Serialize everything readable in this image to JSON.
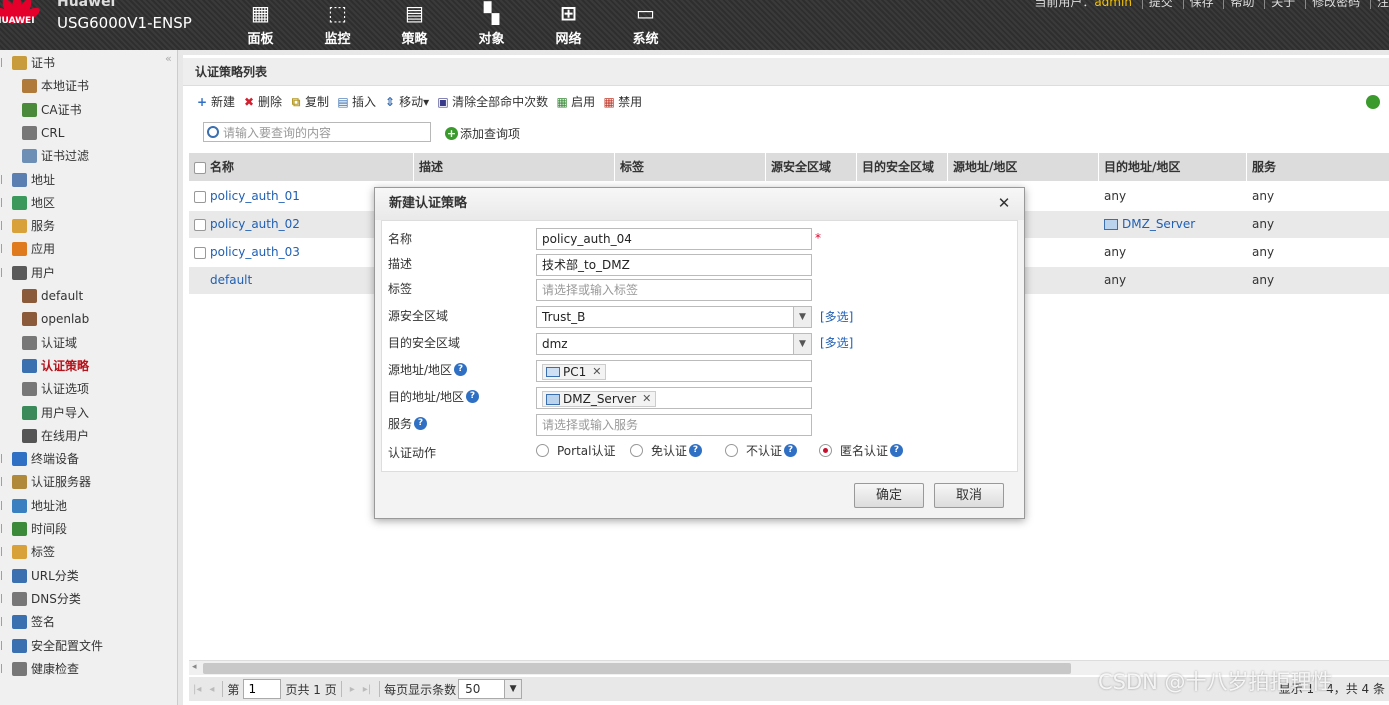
{
  "header": {
    "brand": "Huawei",
    "logo_word": "HUAWEI",
    "device": "USG6000V1-ENSP",
    "nav": [
      {
        "label": "面板",
        "icon": "dashboard-icon"
      },
      {
        "label": "监控",
        "icon": "monitor-icon"
      },
      {
        "label": "策略",
        "icon": "policy-icon"
      },
      {
        "label": "对象",
        "icon": "object-icon"
      },
      {
        "label": "网络",
        "icon": "network-icon"
      },
      {
        "label": "系统",
        "icon": "system-icon"
      }
    ],
    "current_user_label": "当前用户：",
    "current_user": "admin",
    "links": [
      "提交",
      "保存",
      "帮助",
      "关于",
      "修改密码",
      "注"
    ]
  },
  "sidebar": {
    "items": [
      {
        "label": "证书",
        "level": 0,
        "icon": "certificate-icon",
        "color": "#c89b3c"
      },
      {
        "label": "本地证书",
        "level": 1,
        "icon": "local-cert-icon",
        "color": "#b07a3a"
      },
      {
        "label": "CA证书",
        "level": 1,
        "icon": "ca-cert-icon",
        "color": "#4a8a3a"
      },
      {
        "label": "CRL",
        "level": 1,
        "icon": "crl-icon",
        "color": "#777777"
      },
      {
        "label": "证书过滤",
        "level": 1,
        "icon": "cert-filter-icon",
        "color": "#6d8fb5"
      },
      {
        "label": "地址",
        "level": 0,
        "icon": "address-icon",
        "color": "#5a7fb0"
      },
      {
        "label": "地区",
        "level": 0,
        "icon": "region-icon",
        "color": "#3b9a5b"
      },
      {
        "label": "服务",
        "level": 0,
        "icon": "service-icon",
        "color": "#d9a13a"
      },
      {
        "label": "应用",
        "level": 0,
        "icon": "application-icon",
        "color": "#e07a1f"
      },
      {
        "label": "用户",
        "level": 0,
        "icon": "user-icon",
        "color": "#5a5a5a"
      },
      {
        "label": "default",
        "level": 1,
        "icon": "user-group-icon",
        "color": "#8a5a3a"
      },
      {
        "label": "openlab",
        "level": 1,
        "icon": "user-group-icon",
        "color": "#8a5a3a"
      },
      {
        "label": "认证域",
        "level": 1,
        "icon": "auth-domain-icon",
        "color": "#777777"
      },
      {
        "label": "认证策略",
        "level": 1,
        "icon": "auth-policy-icon",
        "color": "#3a6fb0",
        "active": true
      },
      {
        "label": "认证选项",
        "level": 1,
        "icon": "auth-option-icon",
        "color": "#777777"
      },
      {
        "label": "用户导入",
        "level": 1,
        "icon": "user-import-icon",
        "color": "#3a8a5a"
      },
      {
        "label": "在线用户",
        "level": 1,
        "icon": "online-user-icon",
        "color": "#555555"
      },
      {
        "label": "终端设备",
        "level": 0,
        "icon": "terminal-device-icon",
        "color": "#2f6fc4"
      },
      {
        "label": "认证服务器",
        "level": 0,
        "icon": "auth-server-icon",
        "color": "#b08a3a"
      },
      {
        "label": "地址池",
        "level": 0,
        "icon": "address-pool-icon",
        "color": "#3a7fc0"
      },
      {
        "label": "时间段",
        "level": 0,
        "icon": "schedule-icon",
        "color": "#3a8a3a"
      },
      {
        "label": "标签",
        "level": 0,
        "icon": "tag-icon",
        "color": "#d9a13a"
      },
      {
        "label": "URL分类",
        "level": 0,
        "icon": "url-category-icon",
        "color": "#3a6fb0"
      },
      {
        "label": "DNS分类",
        "level": 0,
        "icon": "dns-category-icon",
        "color": "#777777"
      },
      {
        "label": "签名",
        "level": 0,
        "icon": "signature-icon",
        "color": "#3a6fb0"
      },
      {
        "label": "安全配置文件",
        "level": 0,
        "icon": "security-profile-icon",
        "color": "#3a6fb0"
      },
      {
        "label": "健康检查",
        "level": 0,
        "icon": "health-check-icon",
        "color": "#777777"
      }
    ]
  },
  "main": {
    "title": "认证策略列表",
    "toolbar": [
      {
        "label": "新建",
        "icon": "add-icon",
        "color": "#2f6fc4",
        "glyph": "+"
      },
      {
        "label": "删除",
        "icon": "delete-icon",
        "color": "#d2202f",
        "glyph": "✖"
      },
      {
        "label": "复制",
        "icon": "copy-icon",
        "color": "#b59a2a",
        "glyph": "⧉"
      },
      {
        "label": "插入",
        "icon": "insert-icon",
        "color": "#3a6fb0",
        "glyph": "▤"
      },
      {
        "label": "移动▾",
        "icon": "move-icon",
        "color": "#3a6fb0",
        "glyph": "⇕"
      },
      {
        "label": "清除全部命中次数",
        "icon": "clear-hits-icon",
        "color": "#3a3a8a",
        "glyph": "▣"
      },
      {
        "label": "启用",
        "icon": "enable-icon",
        "color": "#3a8a3a",
        "glyph": "▦"
      },
      {
        "label": "禁用",
        "icon": "disable-icon",
        "color": "#c0392b",
        "glyph": "▦"
      }
    ],
    "refresh_label": "刷",
    "search_placeholder": "请输入要查询的内容",
    "add_query_label": "添加查询项",
    "columns": [
      "名称",
      "描述",
      "标签",
      "源安全区域",
      "目的安全区域",
      "源地址/地区",
      "目的地址/地区",
      "服务"
    ],
    "rows": [
      {
        "name": "policy_auth_01",
        "checkbox": true,
        "dst_addr": "any",
        "service": "any"
      },
      {
        "name": "policy_auth_02",
        "checkbox": true,
        "dst_addr": "DMZ_Server",
        "dst_icon": "address-group-icon",
        "service": "any"
      },
      {
        "name": "policy_auth_03",
        "checkbox": true,
        "dst_addr": "any",
        "service": "any"
      },
      {
        "name": "default",
        "checkbox": false,
        "dst_addr": "any",
        "service": "any"
      }
    ],
    "pager": {
      "page_prefix": "第",
      "page_value": "1",
      "page_suffix": "页共 1 页",
      "per_page_label": "每页显示条数",
      "per_page_value": "50",
      "summary": "显示 1 - 4，共 4 条"
    }
  },
  "modal": {
    "title": "新建认证策略",
    "fields": {
      "name_label": "名称",
      "name_value": "policy_auth_04",
      "required_mark": "*",
      "desc_label": "描述",
      "desc_value": "技术部_to_DMZ",
      "tag_label": "标签",
      "tag_placeholder": "请选择或输入标签",
      "src_zone_label": "源安全区域",
      "src_zone_value": "Trust_B",
      "dst_zone_label": "目的安全区域",
      "dst_zone_value": "dmz",
      "multi_select": "[多选]",
      "src_addr_label": "源地址/地区",
      "src_addr_tag": "PC1",
      "dst_addr_label": "目的地址/地区",
      "dst_addr_tag": "DMZ_Server",
      "service_label": "服务",
      "service_placeholder": "请选择或输入服务",
      "action_label": "认证动作",
      "actions": [
        {
          "label": "Portal认证",
          "help": false,
          "selected": false
        },
        {
          "label": "免认证",
          "help": true,
          "selected": false
        },
        {
          "label": "不认证",
          "help": true,
          "selected": false
        },
        {
          "label": "匿名认证",
          "help": true,
          "selected": true
        }
      ]
    },
    "ok_label": "确定",
    "cancel_label": "取消"
  },
  "watermark": "CSDN @十八岁拍拒理性",
  "colors": {
    "accent": "#1f5fb4",
    "brand_red": "#e4002b",
    "help_blue": "#2f6fc4"
  }
}
